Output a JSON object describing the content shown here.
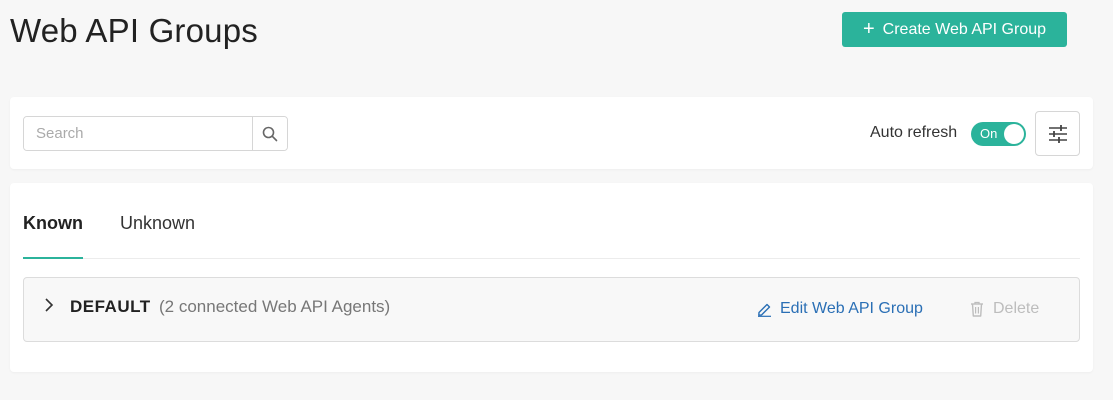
{
  "header": {
    "title": "Web API Groups",
    "create_label": "Create Web API Group"
  },
  "toolbar": {
    "search_placeholder": "Search",
    "search_value": "",
    "auto_refresh_label": "Auto refresh",
    "auto_refresh_state": "On"
  },
  "tabs": [
    {
      "label": "Known",
      "active": true
    },
    {
      "label": "Unknown",
      "active": false
    }
  ],
  "groups": [
    {
      "name": "DEFAULT",
      "agents_text": "(2 connected Web API Agents)",
      "edit_label": "Edit Web API Group",
      "delete_label": "Delete"
    }
  ],
  "colors": {
    "accent": "#2bb39b",
    "link": "#2a6fb5",
    "disabled": "#bdbdbd"
  },
  "icons": {
    "create": "plus-icon",
    "search": "search-icon",
    "filter": "sliders-icon",
    "expand": "chevron-right-icon",
    "edit": "pencil-icon",
    "delete": "trash-icon"
  }
}
